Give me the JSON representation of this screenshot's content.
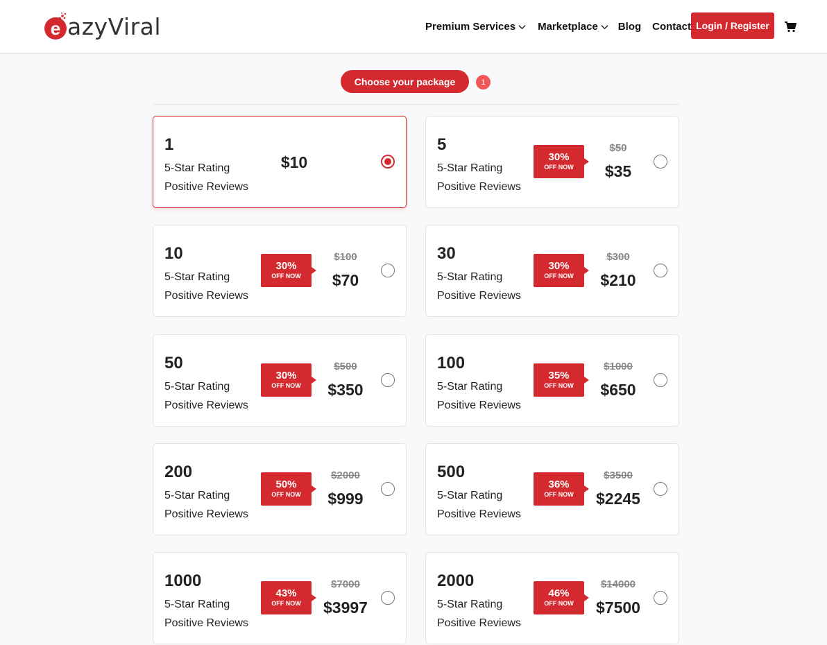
{
  "brand": {
    "logo_letter": "e",
    "logo_text": "azyViral"
  },
  "nav": {
    "items": [
      {
        "label": "Premium Services",
        "dropdown": true
      },
      {
        "label": "Marketplace",
        "dropdown": true
      },
      {
        "label": "Blog",
        "dropdown": false
      },
      {
        "label": "Contact",
        "dropdown": false
      }
    ],
    "login_label": "Login / Register",
    "cart_icon": "cart-icon"
  },
  "step": {
    "label": "Choose your package",
    "number": "1"
  },
  "colors": {
    "accent": "#d42a2f",
    "step_badge": "#f25757"
  },
  "packages": [
    {
      "qty": "1",
      "line1": "5-Star Rating",
      "line2": "Positive Reviews",
      "discount": "",
      "off_label": "",
      "old_price": "",
      "price": "$10",
      "selected": true
    },
    {
      "qty": "5",
      "line1": "5-Star Rating",
      "line2": "Positive Reviews",
      "discount": "30%",
      "off_label": "OFF NOW",
      "old_price": "$50",
      "price": "$35",
      "selected": false
    },
    {
      "qty": "10",
      "line1": "5-Star Rating",
      "line2": "Positive Reviews",
      "discount": "30%",
      "off_label": "OFF NOW",
      "old_price": "$100",
      "price": "$70",
      "selected": false
    },
    {
      "qty": "30",
      "line1": "5-Star Rating",
      "line2": "Positive Reviews",
      "discount": "30%",
      "off_label": "OFF NOW",
      "old_price": "$300",
      "price": "$210",
      "selected": false
    },
    {
      "qty": "50",
      "line1": "5-Star Rating",
      "line2": "Positive Reviews",
      "discount": "30%",
      "off_label": "OFF NOW",
      "old_price": "$500",
      "price": "$350",
      "selected": false
    },
    {
      "qty": "100",
      "line1": "5-Star Rating",
      "line2": "Positive Reviews",
      "discount": "35%",
      "off_label": "OFF NOW",
      "old_price": "$1000",
      "price": "$650",
      "selected": false
    },
    {
      "qty": "200",
      "line1": "5-Star Rating",
      "line2": "Positive Reviews",
      "discount": "50%",
      "off_label": "OFF NOW",
      "old_price": "$2000",
      "price": "$999",
      "selected": false
    },
    {
      "qty": "500",
      "line1": "5-Star Rating",
      "line2": "Positive Reviews",
      "discount": "36%",
      "off_label": "OFF NOW",
      "old_price": "$3500",
      "price": "$2245",
      "selected": false
    },
    {
      "qty": "1000",
      "line1": "5-Star Rating",
      "line2": "Positive Reviews",
      "discount": "43%",
      "off_label": "OFF NOW",
      "old_price": "$7000",
      "price": "$3997",
      "selected": false
    },
    {
      "qty": "2000",
      "line1": "5-Star Rating",
      "line2": "Positive Reviews",
      "discount": "46%",
      "off_label": "OFF NOW",
      "old_price": "$14000",
      "price": "$7500",
      "selected": false
    }
  ]
}
